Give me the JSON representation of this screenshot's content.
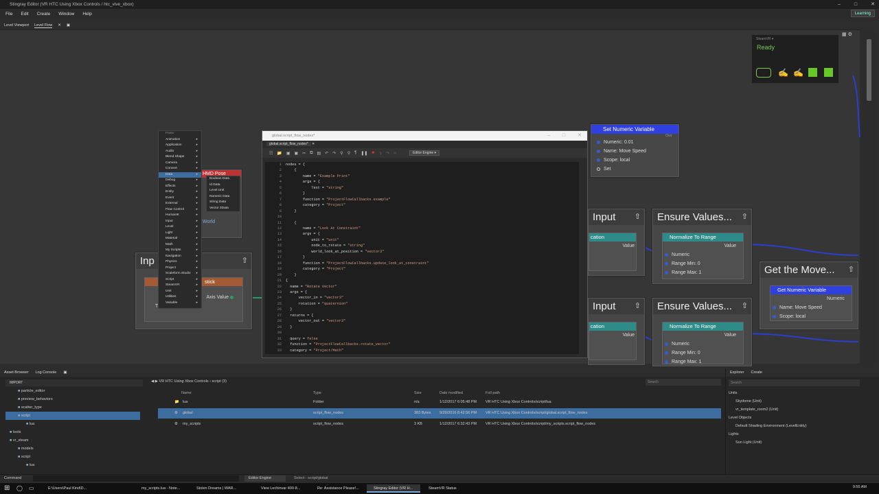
{
  "window": {
    "title": "Stingray Editor (VR HTC Using Xbox Controls / htc_vive_xbox)"
  },
  "menu": [
    "File",
    "Edit",
    "Create",
    "Window",
    "Help"
  ],
  "learning": "Learning",
  "top_tabs": [
    "Level Viewport",
    "Level Flow"
  ],
  "steamvr": {
    "title": "SteamVR ▾",
    "status": "Ready"
  },
  "context_menu": {
    "header": "Paste",
    "items": [
      "Animation",
      "Application",
      "Audio",
      "Blend Shape",
      "Camera",
      "Convert",
      "Data",
      "Debug",
      "Effects",
      "Entity",
      "Event",
      "External",
      "Flow Control",
      "HumanIK",
      "Input",
      "Level",
      "Light",
      "Material",
      "Math",
      "My Scripts",
      "Navigation",
      "Physics",
      "Project",
      "Scaleform Studio",
      "Script",
      "SteamVR",
      "Unit",
      "Utilities",
      "Variable"
    ],
    "selected": "Data"
  },
  "data_submenu": [
    "Boolean Data",
    "Id Data",
    "Level Unit",
    "Numeric Data",
    "String Data",
    "Vector 3Data"
  ],
  "set_numeric": {
    "title": "Set Numeric Variable",
    "out": "Out",
    "rows": [
      "Numeric: 0.01",
      "Name: Move Speed",
      "Scope: local"
    ],
    "set": "Set"
  },
  "nodes": {
    "left_input": {
      "title": "Inp",
      "stick": "stick",
      "axis": "Axis Value",
      "thumb": "Thumbstick: left",
      "hmd": "HMD Pose",
      "pos": "Position",
      "rot": "Rotation",
      "world": "World"
    },
    "input1": {
      "title": "Input",
      "sub": "cation",
      "value": "Value"
    },
    "input2": {
      "title": "Input",
      "sub": "cation",
      "value": "Value"
    },
    "ensure1": {
      "title": "Ensure Values...",
      "sub": "Normalize To Range",
      "value": "Value",
      "rows": [
        "Numeric",
        "Range Min: 0",
        "Range Max: 1"
      ]
    },
    "ensure2": {
      "title": "Ensure Values...",
      "sub": "Normalize To Range",
      "value": "Value",
      "rows": [
        "Numeric",
        "Range Min: 0",
        "Range Max: 1"
      ]
    },
    "getmove": {
      "title": "Get the Move...",
      "sub": "Get Numeric Variable",
      "numeric": "Numeric",
      "rows": [
        "Name: Move Speed",
        "Scope: local"
      ]
    }
  },
  "editor": {
    "title": "global.script_flow_nodes*",
    "tab": "global.script_flow_nodes*",
    "engine": "Editor Engine ▾",
    "lines": [
      "1",
      "2",
      "3",
      "4",
      "5",
      "6",
      "7",
      "8",
      "9",
      "10",
      "11",
      "12",
      "13",
      "14",
      "15",
      "16",
      "17",
      "18",
      "19",
      "20",
      "21",
      "22",
      "23",
      "24",
      "25",
      "26",
      "27",
      "28",
      "29",
      "30",
      "31",
      "32",
      "33"
    ]
  },
  "bottom": {
    "tabs": [
      "Asset Browser",
      "Log Console"
    ],
    "import": "IMPORT",
    "tree": [
      "particle_editor",
      "preview_behaviors",
      "scatter_type",
      "script",
      "lua",
      "tools",
      "vr_steam",
      "models",
      "script",
      "lua"
    ],
    "path": "VR HTC Using Xbox Controls › script (3)",
    "cols": [
      "Name",
      "Type",
      "Size",
      "Date modified",
      "Full path"
    ],
    "files": [
      {
        "name": "lua",
        "type": "Folder",
        "size": "n/a",
        "date": "1/12/2017 6:05:48 PM",
        "path": "VR HTC Using Xbox Controls/script/lua"
      },
      {
        "name": "global",
        "type": "script_flow_nodes",
        "size": "383 Bytes",
        "date": "9/29/2016 8:42:56 PM",
        "path": "VR HTC Using Xbox Controls/script/global.script_flow_nodes"
      },
      {
        "name": "my_scripts",
        "type": "script_flow_nodes",
        "size": "3 KB",
        "date": "1/12/2017 6:32:43 PM",
        "path": "VR HTC Using Xbox Controls/script/my_scripts.script_flow_nodes"
      }
    ],
    "search": "Search"
  },
  "explorer": {
    "tabs": [
      "Explorer",
      "Create"
    ],
    "items": [
      "Units",
      "Skydome (Unit)",
      "vr_template_room2 (Unit)",
      "Level Objects",
      "Default Shading Environment (LevelEntity)",
      "Lights",
      "Sun Light (Unit)"
    ]
  },
  "status": {
    "command": "Command",
    "engine": "Editor Engine",
    "select": "Select - script/global"
  },
  "taskbar": {
    "items": [
      "E:\\Users\\Paul Kind\\D...",
      "my_scripts.lua - Note...",
      "Stolen Dreams | WAR...",
      "View Lechinvar 400-8...",
      "Re: Assistance Please!...",
      "Stingray Editor (VR H...",
      "SteamVR Status"
    ],
    "time": "9:55 AM"
  }
}
